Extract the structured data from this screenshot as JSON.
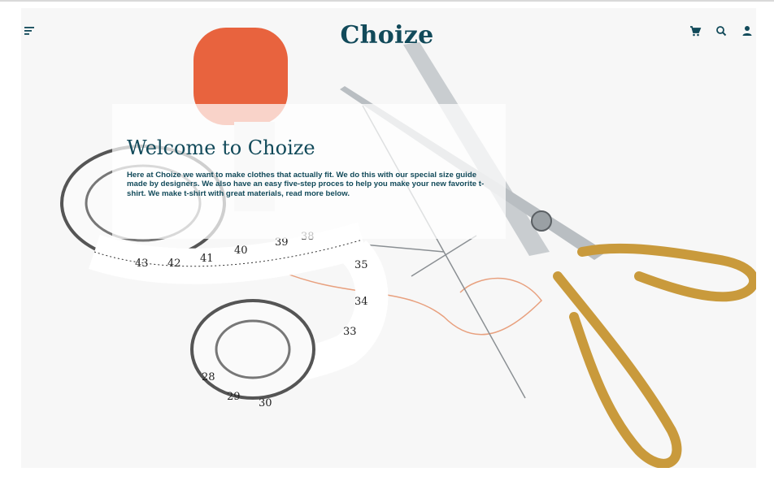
{
  "header": {
    "logo": "Choize",
    "menu_icon": "menu-icon",
    "cart_icon": "cart-icon",
    "search_icon": "search-icon",
    "user_icon": "user-icon"
  },
  "hero": {
    "title": "Welcome to Choize",
    "text": "Here at Choize we want to make clothes that actually fit. We do this with our special size guide made by designers. We also have an easy five-step proces to help you make your new favorite t-shirt. We make t-shirt with great materials, read more below.",
    "tape_numbers": [
      "39",
      "40",
      "41",
      "42",
      "43",
      "38",
      "35",
      "34",
      "33",
      "29",
      "30",
      "28"
    ]
  },
  "colors": {
    "brand": "#124a5a",
    "thread": "#e8633e",
    "gold": "#c99a3c"
  }
}
